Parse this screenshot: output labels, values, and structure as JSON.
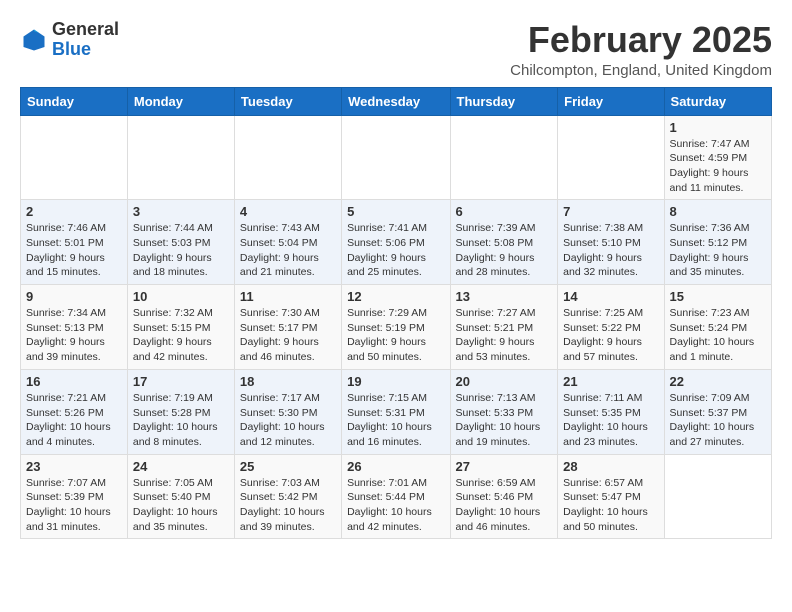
{
  "header": {
    "logo_general": "General",
    "logo_blue": "Blue",
    "month_title": "February 2025",
    "subtitle": "Chilcompton, England, United Kingdom"
  },
  "days_of_week": [
    "Sunday",
    "Monday",
    "Tuesday",
    "Wednesday",
    "Thursday",
    "Friday",
    "Saturday"
  ],
  "weeks": [
    [
      {
        "day": "",
        "info": ""
      },
      {
        "day": "",
        "info": ""
      },
      {
        "day": "",
        "info": ""
      },
      {
        "day": "",
        "info": ""
      },
      {
        "day": "",
        "info": ""
      },
      {
        "day": "",
        "info": ""
      },
      {
        "day": "1",
        "info": "Sunrise: 7:47 AM\nSunset: 4:59 PM\nDaylight: 9 hours and 11 minutes."
      }
    ],
    [
      {
        "day": "2",
        "info": "Sunrise: 7:46 AM\nSunset: 5:01 PM\nDaylight: 9 hours and 15 minutes."
      },
      {
        "day": "3",
        "info": "Sunrise: 7:44 AM\nSunset: 5:03 PM\nDaylight: 9 hours and 18 minutes."
      },
      {
        "day": "4",
        "info": "Sunrise: 7:43 AM\nSunset: 5:04 PM\nDaylight: 9 hours and 21 minutes."
      },
      {
        "day": "5",
        "info": "Sunrise: 7:41 AM\nSunset: 5:06 PM\nDaylight: 9 hours and 25 minutes."
      },
      {
        "day": "6",
        "info": "Sunrise: 7:39 AM\nSunset: 5:08 PM\nDaylight: 9 hours and 28 minutes."
      },
      {
        "day": "7",
        "info": "Sunrise: 7:38 AM\nSunset: 5:10 PM\nDaylight: 9 hours and 32 minutes."
      },
      {
        "day": "8",
        "info": "Sunrise: 7:36 AM\nSunset: 5:12 PM\nDaylight: 9 hours and 35 minutes."
      }
    ],
    [
      {
        "day": "9",
        "info": "Sunrise: 7:34 AM\nSunset: 5:13 PM\nDaylight: 9 hours and 39 minutes."
      },
      {
        "day": "10",
        "info": "Sunrise: 7:32 AM\nSunset: 5:15 PM\nDaylight: 9 hours and 42 minutes."
      },
      {
        "day": "11",
        "info": "Sunrise: 7:30 AM\nSunset: 5:17 PM\nDaylight: 9 hours and 46 minutes."
      },
      {
        "day": "12",
        "info": "Sunrise: 7:29 AM\nSunset: 5:19 PM\nDaylight: 9 hours and 50 minutes."
      },
      {
        "day": "13",
        "info": "Sunrise: 7:27 AM\nSunset: 5:21 PM\nDaylight: 9 hours and 53 minutes."
      },
      {
        "day": "14",
        "info": "Sunrise: 7:25 AM\nSunset: 5:22 PM\nDaylight: 9 hours and 57 minutes."
      },
      {
        "day": "15",
        "info": "Sunrise: 7:23 AM\nSunset: 5:24 PM\nDaylight: 10 hours and 1 minute."
      }
    ],
    [
      {
        "day": "16",
        "info": "Sunrise: 7:21 AM\nSunset: 5:26 PM\nDaylight: 10 hours and 4 minutes."
      },
      {
        "day": "17",
        "info": "Sunrise: 7:19 AM\nSunset: 5:28 PM\nDaylight: 10 hours and 8 minutes."
      },
      {
        "day": "18",
        "info": "Sunrise: 7:17 AM\nSunset: 5:30 PM\nDaylight: 10 hours and 12 minutes."
      },
      {
        "day": "19",
        "info": "Sunrise: 7:15 AM\nSunset: 5:31 PM\nDaylight: 10 hours and 16 minutes."
      },
      {
        "day": "20",
        "info": "Sunrise: 7:13 AM\nSunset: 5:33 PM\nDaylight: 10 hours and 19 minutes."
      },
      {
        "day": "21",
        "info": "Sunrise: 7:11 AM\nSunset: 5:35 PM\nDaylight: 10 hours and 23 minutes."
      },
      {
        "day": "22",
        "info": "Sunrise: 7:09 AM\nSunset: 5:37 PM\nDaylight: 10 hours and 27 minutes."
      }
    ],
    [
      {
        "day": "23",
        "info": "Sunrise: 7:07 AM\nSunset: 5:39 PM\nDaylight: 10 hours and 31 minutes."
      },
      {
        "day": "24",
        "info": "Sunrise: 7:05 AM\nSunset: 5:40 PM\nDaylight: 10 hours and 35 minutes."
      },
      {
        "day": "25",
        "info": "Sunrise: 7:03 AM\nSunset: 5:42 PM\nDaylight: 10 hours and 39 minutes."
      },
      {
        "day": "26",
        "info": "Sunrise: 7:01 AM\nSunset: 5:44 PM\nDaylight: 10 hours and 42 minutes."
      },
      {
        "day": "27",
        "info": "Sunrise: 6:59 AM\nSunset: 5:46 PM\nDaylight: 10 hours and 46 minutes."
      },
      {
        "day": "28",
        "info": "Sunrise: 6:57 AM\nSunset: 5:47 PM\nDaylight: 10 hours and 50 minutes."
      },
      {
        "day": "",
        "info": ""
      }
    ]
  ]
}
